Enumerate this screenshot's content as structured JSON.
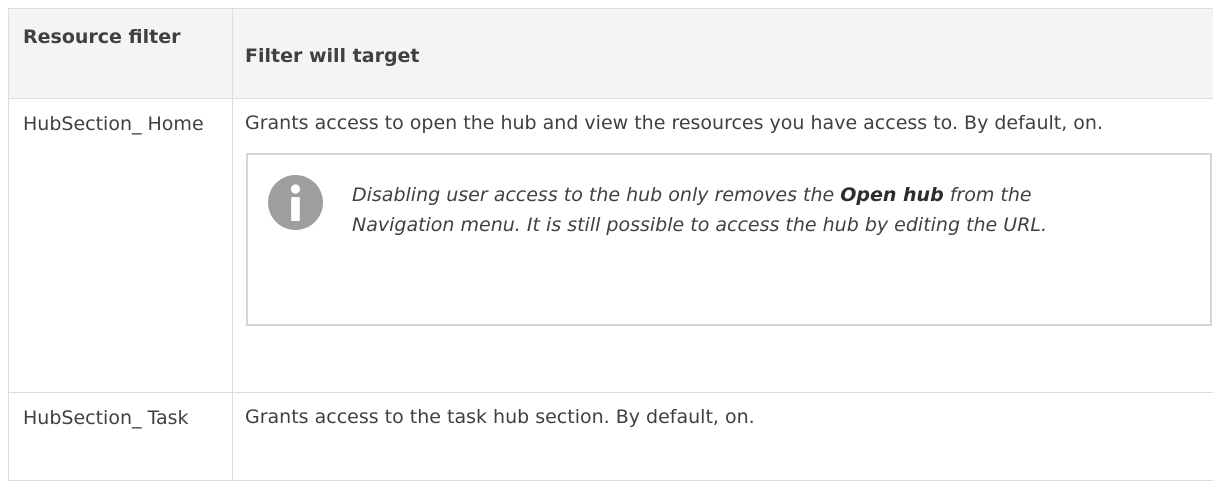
{
  "table": {
    "headers": {
      "resource_filter": "Resource filter",
      "filter_will_target": "Filter will target"
    },
    "rows": [
      {
        "resource": "HubSection_ Home",
        "description": "Grants access to open the hub and view the resources you have access to. By default, on.",
        "note": {
          "icon": "info-icon",
          "text_before": "Disabling user access to the hub only removes the ",
          "text_bold": "Open hub",
          "text_after": " from the Navigation menu. It is still possible to access the hub by editing the URL."
        }
      },
      {
        "resource": "HubSection_ Task",
        "description": "Grants access to the task hub section. By default, on."
      }
    ]
  },
  "colors": {
    "text": "#404040",
    "border": "#dcdcdc",
    "header_bg": "#f4f4f4",
    "note_border": "#d6d6d6",
    "info_icon": "#9e9e9e"
  }
}
